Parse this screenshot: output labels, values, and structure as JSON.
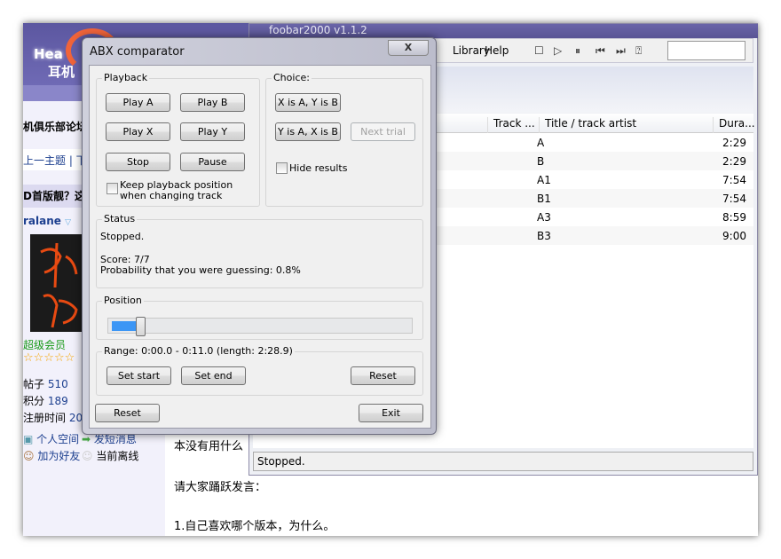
{
  "forum": {
    "logo_text": "HeadPhone",
    "logo_cn": "耳机",
    "forum_title": "机俱乐部论坛",
    "nav": "上一主题 | 下一",
    "thread_title": "D首版靓？这",
    "username": "ralane",
    "rank": "超级会员",
    "stats": [
      {
        "label": "帖子",
        "value": "510"
      },
      {
        "label": "积分",
        "value": "189"
      },
      {
        "label": "注册时间",
        "value": "200"
      }
    ],
    "links": [
      "个人空间",
      "发短消息",
      "加为好友",
      "当前离线"
    ],
    "body_lines": [
      "本没有用什么",
      "请大家踊跃发言：",
      "1.自己喜欢哪个版本，为什么。"
    ]
  },
  "foobar": {
    "title": "foobar2000 v1.1.2",
    "menu": [
      "Library",
      "Help"
    ],
    "toolbar_icons": [
      "stop-icon",
      "play-icon",
      "pause-icon",
      "previous-icon",
      "next-icon",
      "random-icon"
    ],
    "columns": [
      "Track ...",
      "Title / track artist",
      "Dura..."
    ],
    "rows": [
      {
        "title": "A",
        "duration": "2:29"
      },
      {
        "title": "B",
        "duration": "2:29"
      },
      {
        "title": "A1",
        "duration": "7:54"
      },
      {
        "title": "B1",
        "duration": "7:54"
      },
      {
        "title": "A3",
        "duration": "8:59"
      },
      {
        "title": "B3",
        "duration": "9:00"
      }
    ],
    "status": "Stopped."
  },
  "abx": {
    "title": "ABX comparator",
    "close": "X",
    "playback": {
      "label": "Playback",
      "play_a": "Play A",
      "play_b": "Play B",
      "play_x": "Play X",
      "play_y": "Play Y",
      "stop": "Stop",
      "pause": "Pause",
      "keep_position": "Keep playback position when changing track",
      "keep_checked": false
    },
    "choice": {
      "label": "Choice:",
      "xa": "X is A, Y is B",
      "ya": "Y is A, X is B",
      "next": "Next trial",
      "hide_results": "Hide results",
      "hide_checked": false
    },
    "status": {
      "label": "Status",
      "state": "Stopped.",
      "score": "Score: 7/7",
      "probability": "Probability that you were guessing: 0.8%"
    },
    "position": {
      "label": "Position",
      "percent": 5
    },
    "range": {
      "label": "Range: 0:00.0 - 0:11.0 (length: 2:28.9)",
      "set_start": "Set start",
      "set_end": "Set end",
      "reset": "Reset"
    },
    "reset": "Reset",
    "exit": "Exit"
  }
}
